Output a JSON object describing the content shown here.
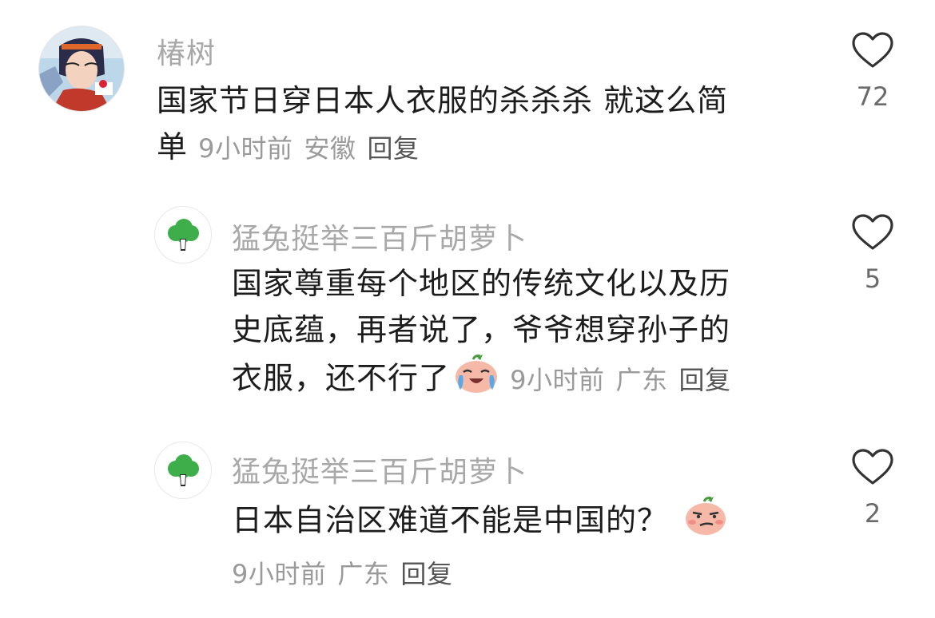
{
  "comments": [
    {
      "username": "椿树",
      "text_line1": "国家节日穿日本人衣服的杀杀杀 就这么简",
      "text_line2": "单",
      "time": "9小时前",
      "location": "安徽",
      "reply_label": "回复",
      "likes": "72",
      "avatar_icon": "anime-avatar"
    },
    {
      "username": "猛兔挺举三百斤胡萝卜",
      "text_line1": "国家尊重每个地区的传统文化以及历",
      "text_line2": "史底蕴，再者说了，爷爷想穿孙子的",
      "text_line3": "衣服，还不行了",
      "emoji": "laughing-crying-emoji",
      "time": "9小时前",
      "location": "广东",
      "reply_label": "回复",
      "likes": "5",
      "avatar_icon": "broccoli-icon"
    },
    {
      "username": "猛兔挺举三百斤胡萝卜",
      "text_line1": "日本自治区难道不能是中国的？",
      "emoji": "smirk-emoji",
      "time": "9小时前",
      "location": "广东",
      "reply_label": "回复",
      "likes": "2",
      "avatar_icon": "broccoli-icon"
    }
  ],
  "colors": {
    "username": "#a8a8a8",
    "text": "#1c1c1c",
    "meta": "#9a9a9a",
    "broccoli": "#3eae4b"
  }
}
